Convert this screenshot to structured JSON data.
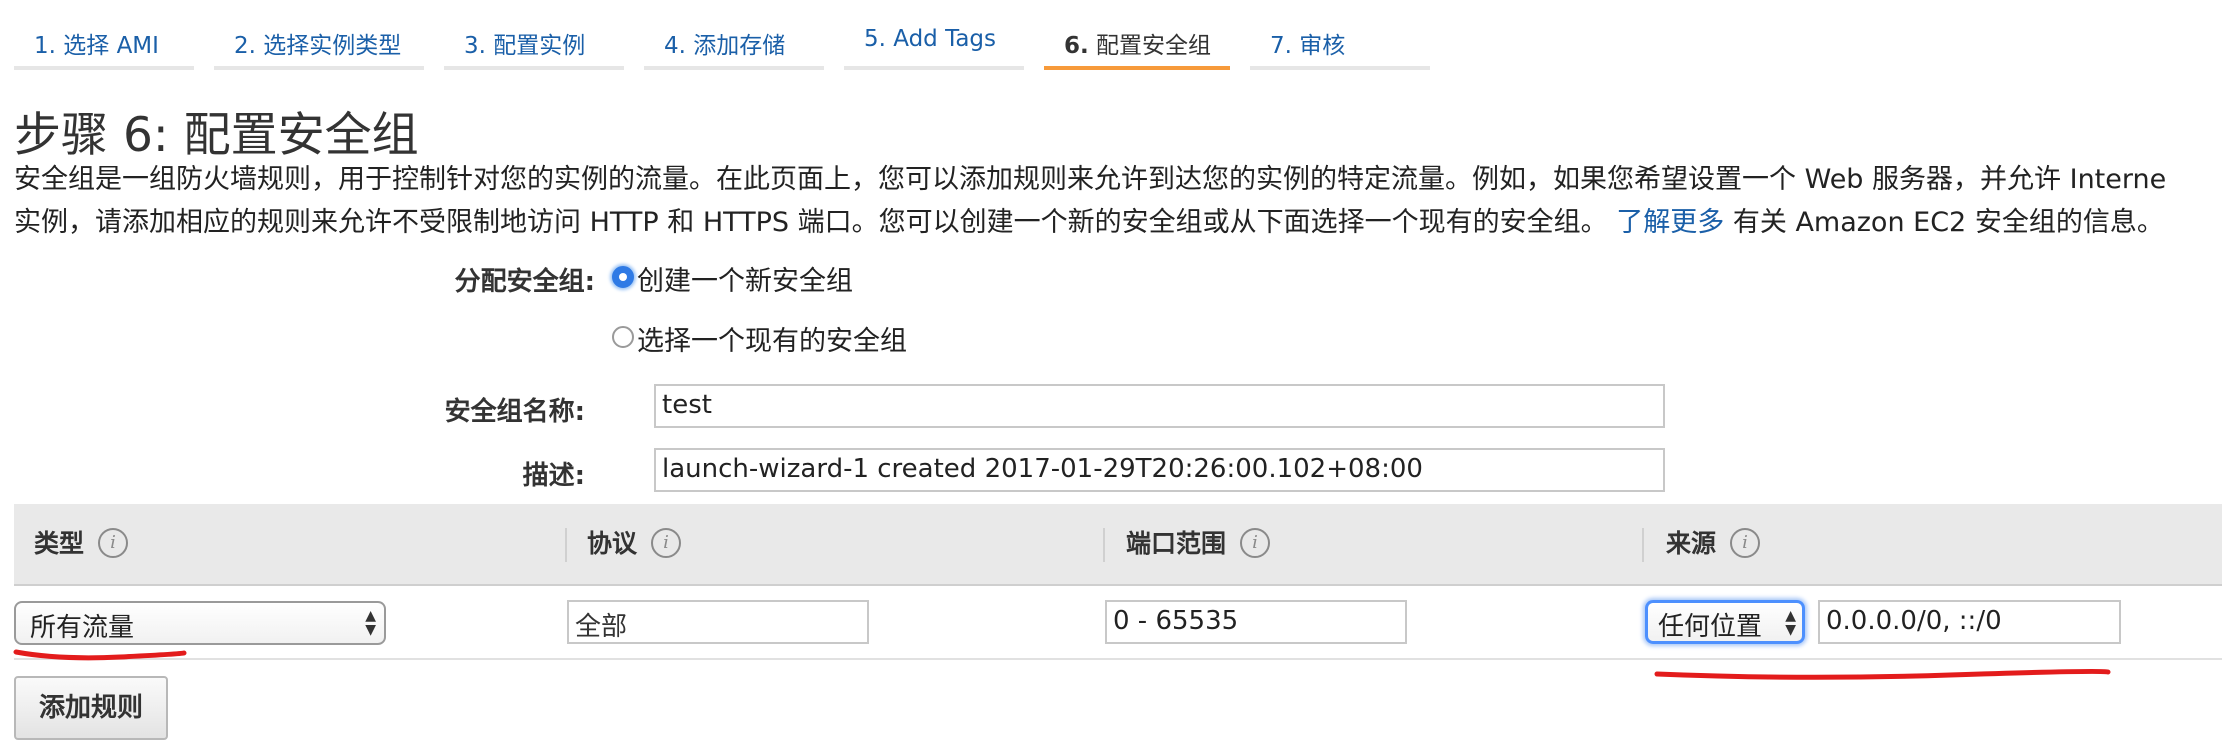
{
  "steps": [
    {
      "label": "1. 选择 AMI"
    },
    {
      "label": "2. 选择实例类型"
    },
    {
      "label": "3. 配置实例"
    },
    {
      "label": "4. 添加存储"
    },
    {
      "label": "5. Add Tags"
    },
    {
      "num": "6.",
      "label": " 配置安全组"
    },
    {
      "label": "7. 审核"
    }
  ],
  "page": {
    "title": "步骤 6: 配置安全组",
    "desc_line1": "安全组是一组防火墙规则，用于控制针对您的实例的流量。在此页面上，您可以添加规则来允许到达您的实例的特定流量。例如，如果您希望设置一个 Web 服务器，并允许 Interne",
    "desc_line2_a": "实例，请添加相应的规则来允许不受限制地访问 HTTP 和 HTTPS 端口。您可以创建一个新的安全组或从下面选择一个现有的安全组。",
    "learn_more": "了解更多",
    "desc_line2_b": "有关 Amazon EC2 安全组的信息。"
  },
  "form": {
    "assign_label": "分配安全组:",
    "option_new": "创建一个新安全组",
    "option_existing": "选择一个现有的安全组",
    "name_label": "安全组名称:",
    "name_value": "test",
    "desc_label": "描述:",
    "desc_value": "launch-wizard-1 created 2017-01-29T20:26:00.102+08:00"
  },
  "table": {
    "headers": {
      "type": "类型",
      "protocol": "协议",
      "port_range": "端口范围",
      "source": "来源"
    },
    "row": {
      "type": "所有流量",
      "protocol": "全部",
      "port_range": "0 - 65535",
      "source_select": "任何位置",
      "source_value": "0.0.0.0/0, ::/0"
    }
  },
  "add_rule_button": "添加规则",
  "colors": {
    "link": "#1a5fa8",
    "active_tab": "#f79a3a",
    "annotation": "#e31c1c",
    "focus": "#4d90fe"
  }
}
